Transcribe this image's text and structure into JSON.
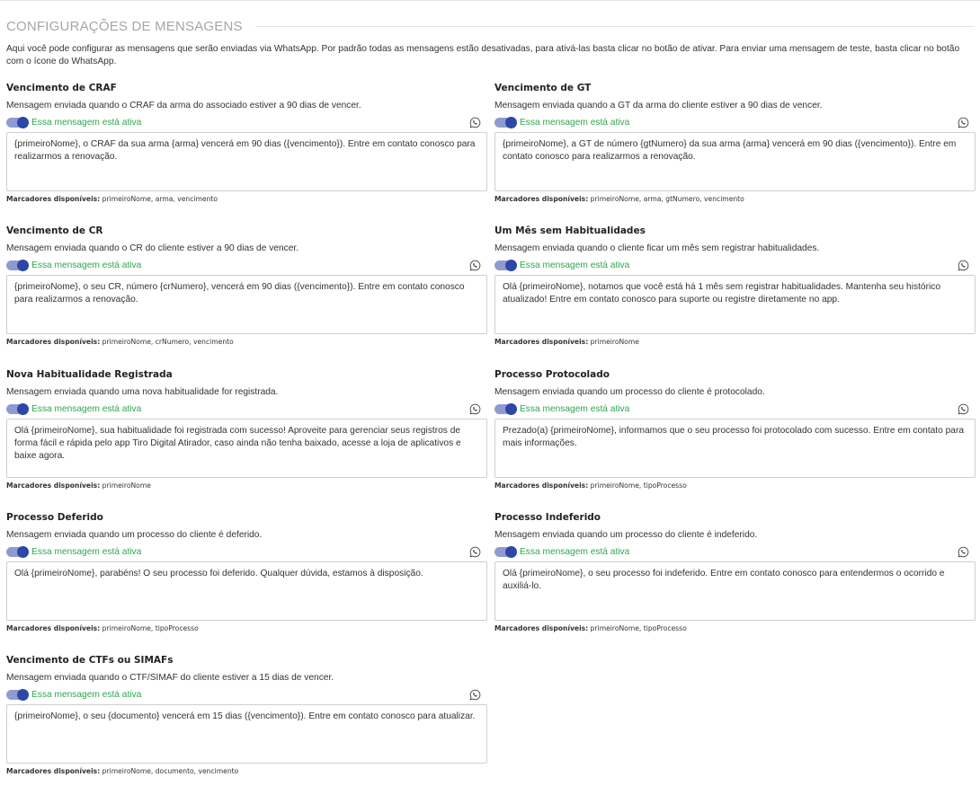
{
  "page": {
    "title": "CONFIGURAÇÕES DE MENSAGENS",
    "intro": "Aqui você pode configurar as mensagens que serão enviadas via WhatsApp. Por padrão todas as mensagens estão desativadas, para ativá-las basta clicar no botão de ativar. Para enviar uma mensagem de teste, basta clicar no botão com o ícone do WhatsApp.",
    "markers_label": "Marcadores disponíveis:",
    "accent_color": "#2e46a6",
    "status_color": "#2ea64e"
  },
  "cards": [
    {
      "title": "Vencimento de CRAF",
      "description": "Mensagem enviada quando o CRAF da arma do associado estiver a 90 dias de vencer.",
      "active": true,
      "status": "Essa mensagem está ativa",
      "message": "{primeiroNome}, o CRAF da sua arma {arma} vencerá em 90 dias ({vencimento}). Entre em contato conosco para realizarmos a renovação.",
      "markers": "primeiroNome, arma, vencimento"
    },
    {
      "title": "Vencimento de GT",
      "description": "Mensagem enviada quando a GT da arma do cliente estiver a 90 dias de vencer.",
      "active": true,
      "status": "Essa mensagem está ativa",
      "message": "{primeiroNome}, a GT de número {gtNumero} da sua arma {arma} vencerá em 90 dias ({vencimento}). Entre em contato conosco para realizarmos a renovação.",
      "markers": "primeiroNome, arma, gtNumero, vencimento"
    },
    {
      "title": "Vencimento de CR",
      "description": "Mensagem enviada quando o CR do cliente estiver a 90 dias de vencer.",
      "active": true,
      "status": "Essa mensagem está ativa",
      "message": "{primeiroNome}, o seu CR, número {crNumero}, vencerá em 90 dias ({vencimento}). Entre em contato conosco para realizarmos a renovação.",
      "markers": "primeiroNome, crNumero, vencimento"
    },
    {
      "title": "Um Mês sem Habitualidades",
      "description": "Mensagem enviada quando o cliente ficar um mês sem registrar habitualidades.",
      "active": true,
      "status": "Essa mensagem está ativa",
      "message": "Olá {primeiroNome}, notamos que você está há 1 mês sem registrar habitualidades. Mantenha seu histórico atualizado! Entre em contato conosco para suporte ou registre diretamente no app.",
      "markers": "primeiroNome"
    },
    {
      "title": "Nova Habitualidade Registrada",
      "description": "Mensagem enviada quando uma nova habitualidade for registrada.",
      "active": true,
      "status": "Essa mensagem está ativa",
      "message": "Olá {primeiroNome}, sua habitualidade foi registrada com sucesso! Aproveite para gerenciar seus registros de forma fácil e rápida pelo app Tiro Digital Atirador, caso ainda não tenha baixado, acesse a loja de aplicativos e baixe agora.",
      "markers": "primeiroNome"
    },
    {
      "title": "Processo Protocolado",
      "description": "Mensagem enviada quando um processo do cliente é protocolado.",
      "active": true,
      "status": "Essa mensagem está ativa",
      "message": "Prezado(a) {primeiroNome}, informamos que o seu processo foi protocolado com sucesso. Entre em contato para mais informações.",
      "markers": "primeiroNome, tipoProcesso"
    },
    {
      "title": "Processo Deferido",
      "description": "Mensagem enviada quando um processo do cliente é deferido.",
      "active": true,
      "status": "Essa mensagem está ativa",
      "message": "Olá {primeiroNome}, parabéns! O seu processo foi deferido. Qualquer dúvida, estamos à disposição.",
      "markers": "primeiroNome, tipoProcesso"
    },
    {
      "title": "Processo Indeferido",
      "description": "Mensagem enviada quando um processo do cliente é indeferido.",
      "active": true,
      "status": "Essa mensagem está ativa",
      "message": "Olá {primeiroNome}, o seu processo foi indeferido. Entre em contato conosco para entendermos o ocorrido e auxiliá-lo.",
      "markers": "primeiroNome, tipoProcesso"
    },
    {
      "title": "Vencimento de CTFs ou SIMAFs",
      "description": "Mensagem enviada quando o CTF/SIMAF do cliente estiver a 15 dias de vencer.",
      "active": true,
      "status": "Essa mensagem está ativa",
      "message": "{primeiroNome}, o seu {documento} vencerá em 15 dias ({vencimento}). Entre em contato conosco para atualizar.",
      "markers": "primeiroNome, documento, vencimento"
    }
  ]
}
